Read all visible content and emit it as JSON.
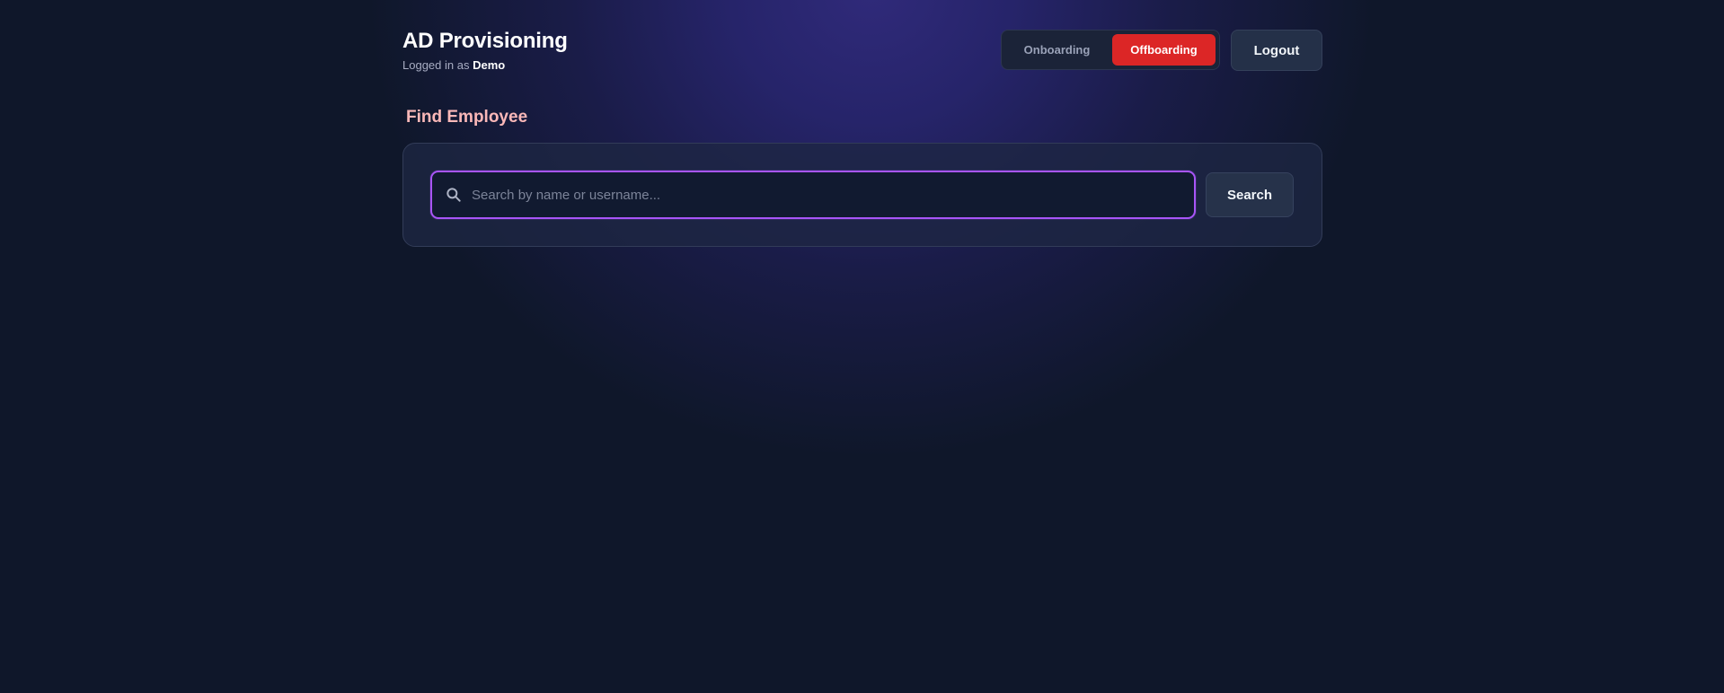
{
  "header": {
    "title": "AD Provisioning",
    "logged_in_prefix": "Logged in as",
    "username": "Demo"
  },
  "mode_toggle": {
    "options": [
      {
        "label": "Onboarding",
        "active": false
      },
      {
        "label": "Offboarding",
        "active": true
      }
    ]
  },
  "logout_label": "Logout",
  "find_section": {
    "title": "Find Employee",
    "search_placeholder": "Search by name or username...",
    "search_value": "",
    "search_button_label": "Search"
  },
  "icons": {
    "search": "search-icon"
  },
  "colors": {
    "accent_active": "#dc2626",
    "input_focus_border": "#a855f7",
    "section_title": "#fbb8b8",
    "background": "#0f172a"
  }
}
